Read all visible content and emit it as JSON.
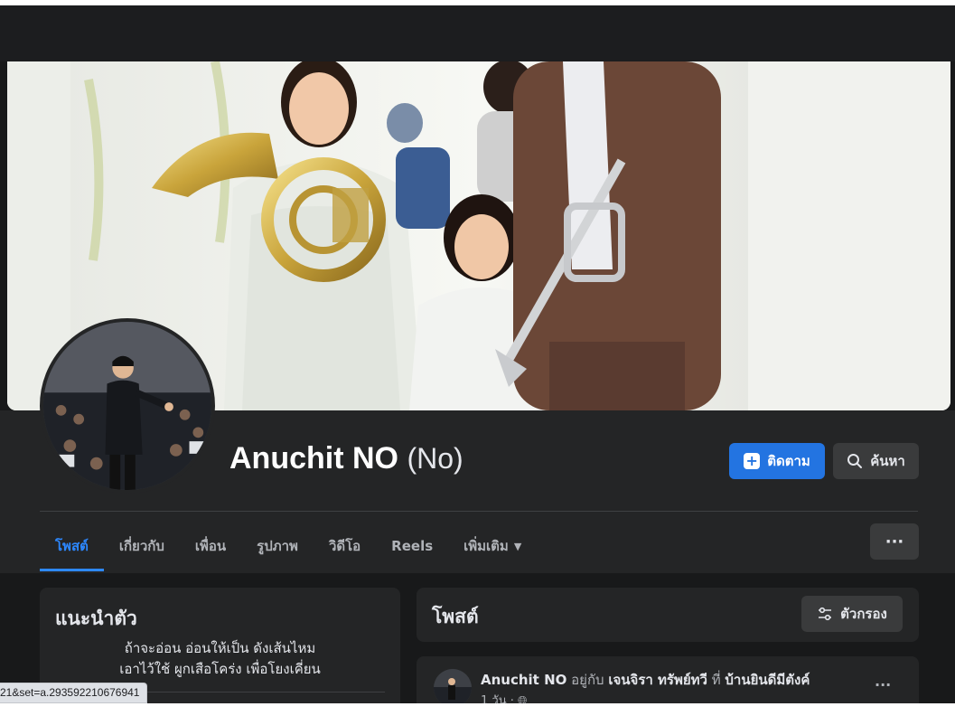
{
  "profile": {
    "name": "Anuchit NO",
    "alternate_name": "(No)"
  },
  "actions": {
    "follow_label": "ติดตาม",
    "search_label": "ค้นหา",
    "more_label": "···"
  },
  "tabs": [
    {
      "label": "โพสต์",
      "active": true
    },
    {
      "label": "เกี่ยวกับ",
      "active": false
    },
    {
      "label": "เพื่อน",
      "active": false
    },
    {
      "label": "รูปภาพ",
      "active": false
    },
    {
      "label": "วิดีโอ",
      "active": false
    },
    {
      "label": "Reels",
      "active": false
    },
    {
      "label": "เพิ่มเติม",
      "active": false
    }
  ],
  "intro": {
    "title": "แนะนำตัว",
    "bio_line1": "ถ้าจะอ่อน อ่อนให้เป็น ดังเส้นไหม",
    "bio_line2": "เอาไว้ใช้ ผูกเสือโคร่ง เพื่อโยงเคี่ยน"
  },
  "posts": {
    "title": "โพสต์",
    "filter_label": "ตัวกรอง"
  },
  "post": {
    "author": "Anuchit NO",
    "with_text": "อยู่กับ",
    "tagged": "เจนจิรา ทรัพย์ทวี",
    "at_text": "ที่",
    "place": "บ้านยินดีมีตังค์",
    "time": "1 วัน ·",
    "privacy_icon": "globe-icon"
  },
  "status_bar": {
    "url": "21&set=a.293592210676941"
  },
  "colors": {
    "accent": "#2374e1",
    "active_tab": "#2d88ff",
    "background": "#18191a",
    "card": "#242526"
  }
}
